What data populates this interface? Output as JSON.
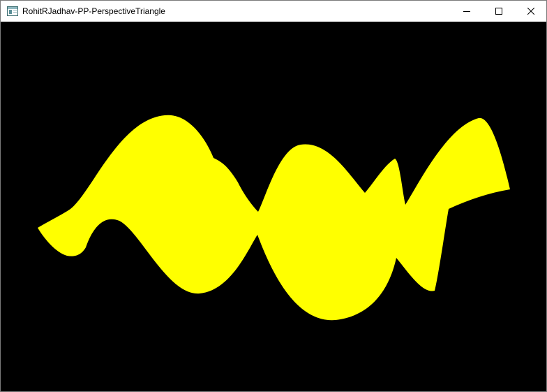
{
  "window": {
    "title": "RohitRJadhav-PP-PerspectiveTriangle",
    "icon": "app-window-icon",
    "buttons": {
      "minimize": "minimize-icon",
      "maximize": "maximize-icon",
      "close": "close-icon"
    }
  },
  "canvas": {
    "background_color": "#000000",
    "shape_color": "#ffff00",
    "shape": "waving-flag-ribbon"
  }
}
